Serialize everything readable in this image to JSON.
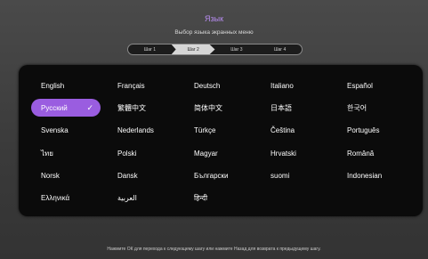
{
  "header": {
    "title": "Язык",
    "subtitle": "Выбор языка экранных меню"
  },
  "steps": [
    {
      "label": "Шаг 1",
      "active": false
    },
    {
      "label": "Шаг 2",
      "active": true
    },
    {
      "label": "Шаг 3",
      "active": false
    },
    {
      "label": "Шаг 4",
      "active": false
    }
  ],
  "languages": [
    [
      "English",
      "Français",
      "Deutsch",
      "Italiano",
      "Español"
    ],
    [
      "Русский",
      "繁體中文",
      "简体中文",
      "日本語",
      "한국어"
    ],
    [
      "Svenska",
      "Nederlands",
      "Türkçe",
      "Čeština",
      "Português"
    ],
    [
      "ไทย",
      "Polski",
      "Magyar",
      "Hrvatski",
      "Română"
    ],
    [
      "Norsk",
      "Dansk",
      "Български",
      "suomi",
      "Indonesian"
    ],
    [
      "Ελληνικά",
      "العربية",
      "हिन्दी",
      "",
      ""
    ]
  ],
  "selected_language": "Русский",
  "footer": "Нажмите ОК для перехода к следующему шагу или нажмите Назад для возврата к предыдущему шагу.",
  "colors": {
    "accent": "#9a5de0",
    "title": "#b78cf0"
  }
}
